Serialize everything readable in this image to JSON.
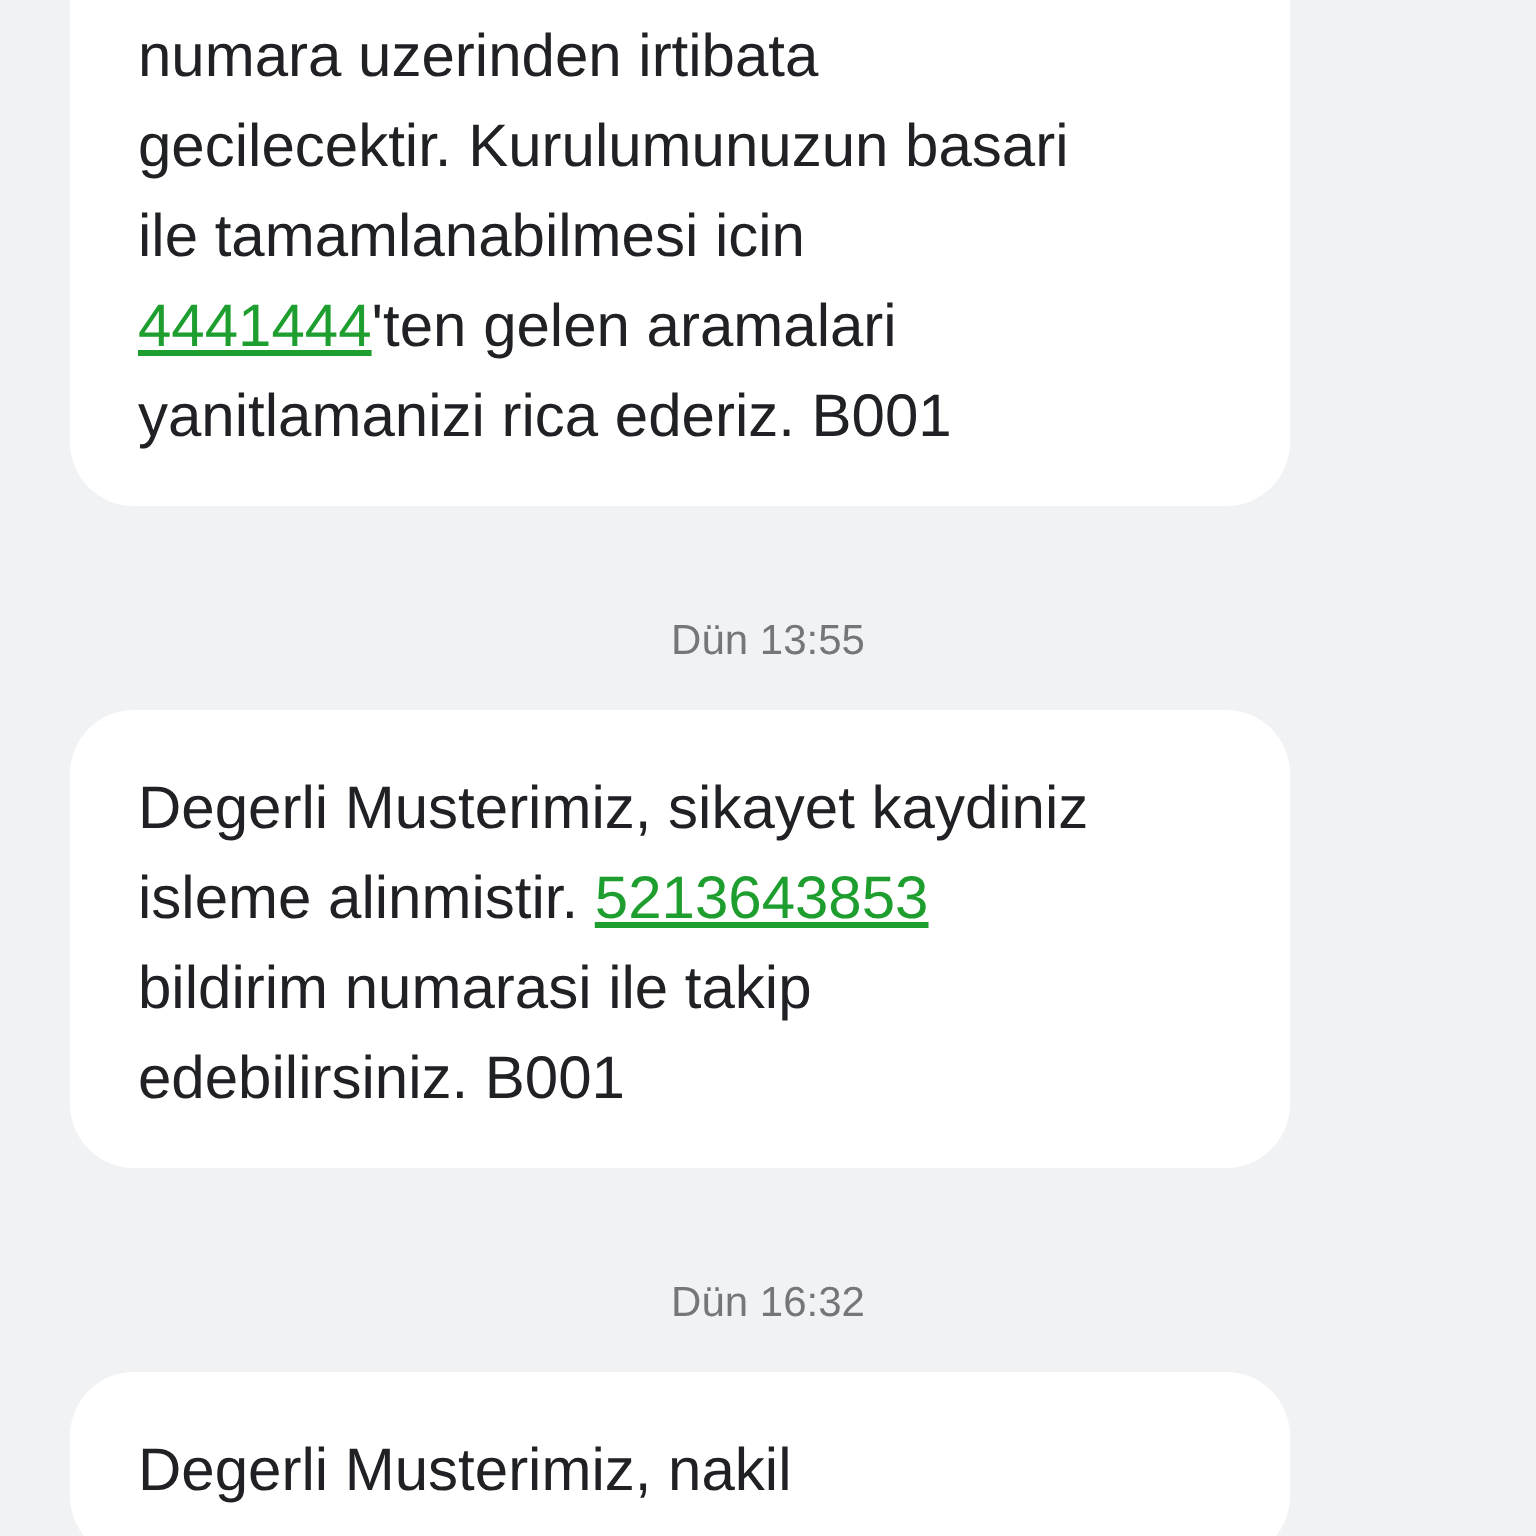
{
  "messages": [
    {
      "segments": [
        {
          "kind": "text",
          "text": "numara uzerinden irtibata\ngecilecektir. Kurulumunuzun basari\nile tamamlanabilmesi icin\n"
        },
        {
          "kind": "link",
          "text": "4441444"
        },
        {
          "kind": "text",
          "text": "'ten gelen aramalari\nyanitlamanizi rica ederiz. B001"
        }
      ]
    },
    {
      "timestamp": "Dün 13:55",
      "segments": [
        {
          "kind": "text",
          "text": "Degerli Musterimiz, sikayet kaydiniz\nisleme alinmistir. "
        },
        {
          "kind": "link",
          "text": "5213643853"
        },
        {
          "kind": "text",
          "text": "\nbildirim numarasi ile takip\nedebilirsiniz. B001"
        }
      ]
    },
    {
      "timestamp": "Dün 16:32",
      "segments": [
        {
          "kind": "text",
          "text": "Degerli Musterimiz, nakil"
        }
      ]
    }
  ]
}
